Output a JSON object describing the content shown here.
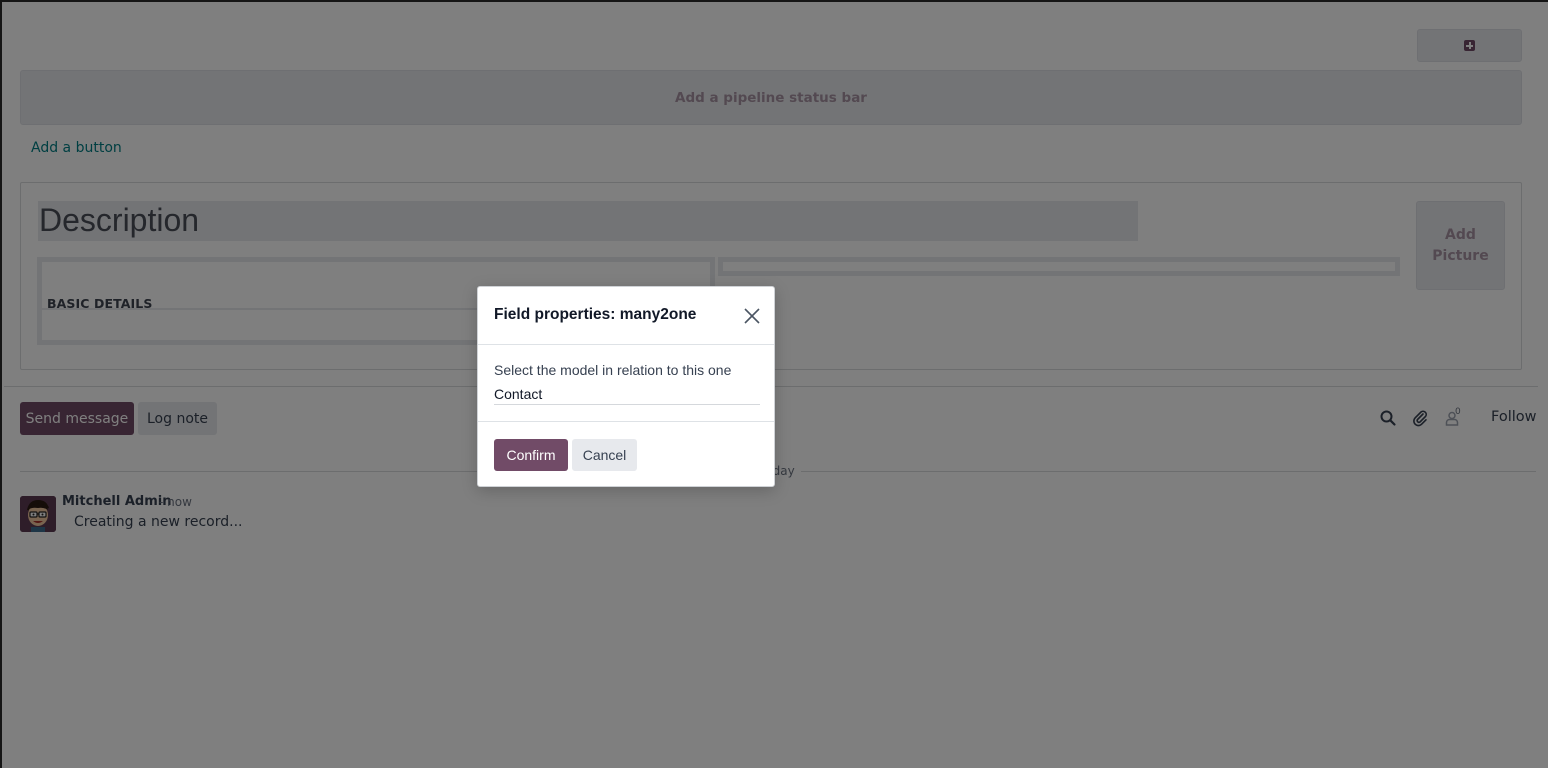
{
  "form": {
    "add_tab_icon": "plus-square-icon",
    "pipeline_label": "Add a pipeline status bar",
    "add_button_label": "Add a button",
    "description_placeholder": "Description",
    "picture_label_line1": "Add",
    "picture_label_line2": "Picture",
    "group_title": "BASIC DETAILS"
  },
  "chatter": {
    "send_message_label": "Send message",
    "log_note_label": "Log note",
    "search_icon": "search-icon",
    "attachment_icon": "paperclip-icon",
    "followers_icon": "user-icon",
    "followers_count": "0",
    "follow_label": "Follow",
    "date_separator": "Today",
    "messages": [
      {
        "author": "Mitchell Admin",
        "time": "- now",
        "body": "Creating a new record..."
      }
    ]
  },
  "modal": {
    "title": "Field properties: many2one",
    "close_icon": "close-icon",
    "field_label": "Select the model in relation to this one",
    "field_value": "Contact",
    "confirm_label": "Confirm",
    "cancel_label": "Cancel"
  },
  "colors": {
    "primary": "#714b67",
    "link": "#017e84",
    "backdrop": "rgba(0,0,0,0.5)"
  }
}
